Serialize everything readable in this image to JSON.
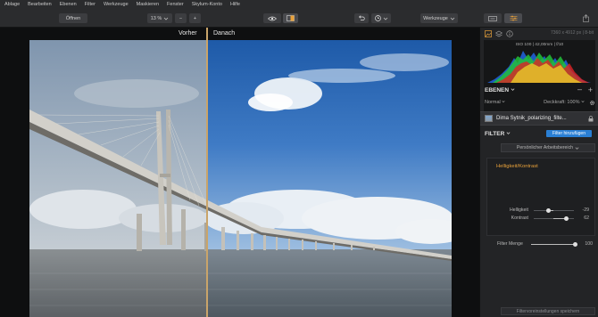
{
  "menu": [
    "Ablage",
    "Bearbeiten",
    "Ebenen",
    "Filter",
    "Werkzeuge",
    "Maskieren",
    "Fenster",
    "Skylum-Konto",
    "Hilfe"
  ],
  "toolbar": {
    "open_label": "Öffnen",
    "zoom_value": "13 %",
    "zoom_minus": "−",
    "zoom_plus": "+",
    "tools_label": "Werkzeuge"
  },
  "canvas": {
    "before_label": "Vorher",
    "after_label": "Danach",
    "split_fraction": 0.42
  },
  "image_info": "7360 x 4912 px | 8-bit",
  "histogram": {
    "exif": "ISO 100  |  42,00mm  |  f/10"
  },
  "layers": {
    "title": "EBENEN",
    "blend_mode": "Normal",
    "opacity_label": "Deckkraft: 100%",
    "layer_name": "Dima Sytnik_polarizing_filte..."
  },
  "filters": {
    "title": "FILTER",
    "add_label": "Filter hinzufügen",
    "workspace_label": "Persönlicher Arbeitsbereich",
    "filter_name": "Helligkeit/Kontrast",
    "sliders": [
      {
        "label": "Helligkeit",
        "value": "-29",
        "numeric": -29
      },
      {
        "label": "Kontrast",
        "value": "62",
        "numeric": 62
      }
    ],
    "amount_label": "Filter Menge",
    "amount_value": "100",
    "save_preset": "Filtervoreinstellungen speichern"
  },
  "colors": {
    "accent_blue": "#2a7fd4",
    "filter_orange": "#e8a13a",
    "split_line": "#c9a46a"
  }
}
